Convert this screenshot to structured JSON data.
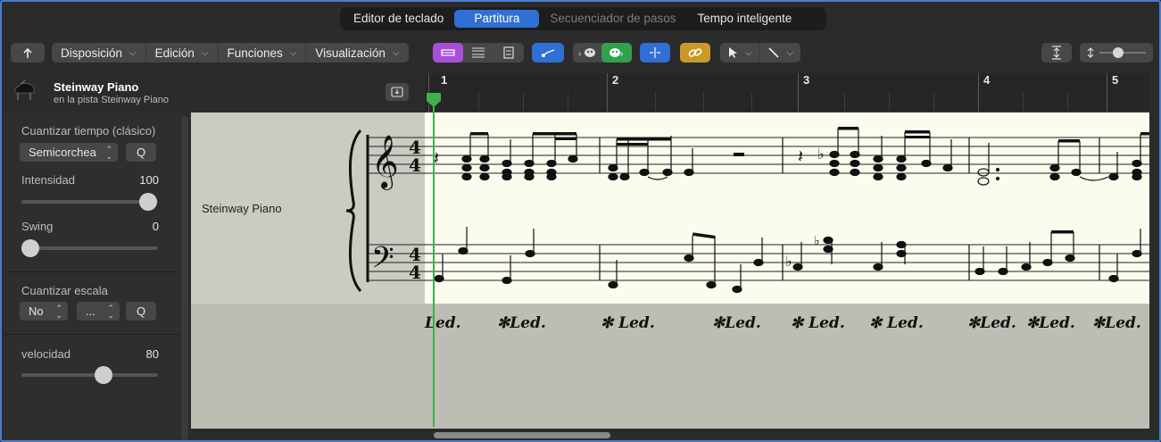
{
  "tabs": [
    {
      "label": "Editor de teclado",
      "state": "normal"
    },
    {
      "label": "Partitura",
      "state": "active"
    },
    {
      "label": "Secuenciador de pasos",
      "state": "dim"
    },
    {
      "label": "Tempo inteligente",
      "state": "normal"
    }
  ],
  "toolbar": {
    "back_icon": "catch-arrow-icon",
    "menus": [
      {
        "label": "Disposición"
      },
      {
        "label": "Edición"
      },
      {
        "label": "Funciones"
      },
      {
        "label": "Visualización"
      }
    ],
    "accent_purple": "#a94fd6",
    "accent_blue": "#2f6fd6",
    "accent_green": "#31a150",
    "accent_gold": "#c89a2a"
  },
  "header": {
    "track_name": "Steinway Piano",
    "track_subtitle": "en la pista Steinway Piano"
  },
  "ruler": {
    "bars": [
      "1",
      "2",
      "3",
      "4",
      "5"
    ]
  },
  "inspector": {
    "quantize_label": "Cuantizar tiempo (clásico)",
    "quantize_value": "Semicorchea",
    "q_label": "Q",
    "strength_label": "Intensidad",
    "strength_value": "100",
    "strength_level": 1.0,
    "swing_label": "Swing",
    "swing_value": "0",
    "swing_level": 0.0,
    "scale_label": "Cuantizar escala",
    "scale_value_1": "No",
    "scale_value_2": "...",
    "velocity_label": "velocidad",
    "velocity_value": "80",
    "velocity_level": 0.63
  },
  "score": {
    "instrument_label": "Steinway Piano",
    "time_signature": "4/4",
    "pedal_marks": [
      "Led.",
      "✻Led.",
      "✻ Led.",
      "✻Led.",
      "✻ Led.",
      "✻ Led.",
      "✻Led.",
      "✻Led.",
      "✻Led."
    ]
  }
}
